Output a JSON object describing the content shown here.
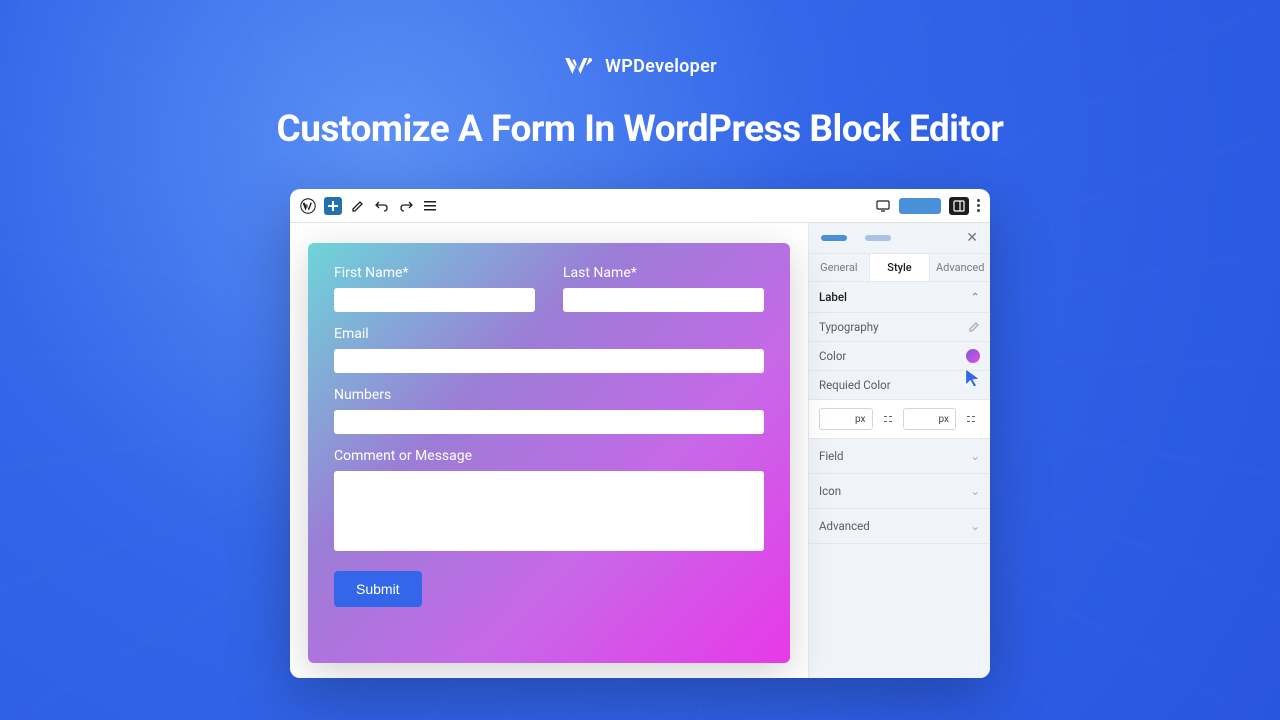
{
  "brand": {
    "name": "WPDeveloper"
  },
  "headline": "Customize A Form In WordPress Block Editor",
  "form": {
    "first_name_label": "First Name*",
    "last_name_label": "Last Name*",
    "email_label": "Email",
    "numbers_label": "Numbers",
    "comment_label": "Comment or Message",
    "submit_label": "Submit"
  },
  "sidebar": {
    "tabs": {
      "general": "General",
      "style": "Style",
      "advanced": "Advanced"
    },
    "panel_label": "Label",
    "rows": {
      "typography": "Typography",
      "color": "Color",
      "required_color": "Requied Color"
    },
    "units": {
      "px1": "px",
      "px2": "px"
    },
    "collapsed": {
      "field": "Field",
      "icon": "Icon",
      "advanced": "Advanced"
    }
  },
  "colors": {
    "accent": "#3366e8"
  }
}
